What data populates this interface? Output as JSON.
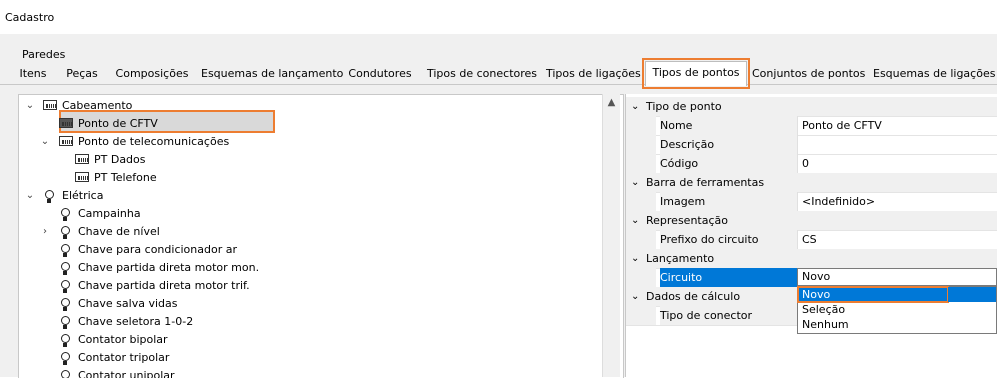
{
  "window": {
    "title": "Cadastro"
  },
  "section_label": "Paredes",
  "tabs": [
    "Itens",
    "Peças",
    "Composições",
    "Esquemas de lançamento",
    "Condutores",
    "Tipos de conectores",
    "Tipos de ligações",
    "Tipos de pontos",
    "Conjuntos de pontos",
    "Esquemas de ligações"
  ],
  "active_tab": "Tipos de pontos",
  "tree": {
    "cabeamento": "Cabeamento",
    "ponto_cftv": "Ponto de CFTV",
    "ponto_telecom": "Ponto de telecomunicações",
    "pt_dados": "PT Dados",
    "pt_telefone": "PT Telefone",
    "eletrica": "Elétrica",
    "eletrica_items": [
      "Campainha",
      "Chave de nível",
      "Chave para condicionador ar",
      "Chave partida direta motor mon.",
      "Chave partida direta motor trif.",
      "Chave salva vidas",
      "Chave seletora 1-0-2",
      "Contator bipolar",
      "Contator tripolar",
      "Contator unipolar"
    ]
  },
  "properties": {
    "cat_tipo": "Tipo de ponto",
    "nome_key": "Nome",
    "nome_val": "Ponto de CFTV",
    "descricao_key": "Descrição",
    "descricao_val": "",
    "codigo_key": "Código",
    "codigo_val": "0",
    "cat_barra": "Barra de ferramentas",
    "imagem_key": "Imagem",
    "imagem_val": "<Indefinido>",
    "cat_repr": "Representação",
    "prefixo_key": "Prefixo do circuito",
    "prefixo_val": "CS",
    "cat_lanc": "Lançamento",
    "circuito_key": "Circuito",
    "circuito_val": "Novo",
    "cat_dados": "Dados de cálculo",
    "conector_key": "Tipo de conector"
  },
  "dropdown_options": [
    "Novo",
    "Seleção",
    "Nenhum"
  ],
  "colors": {
    "highlight": "#ed7d31",
    "selection": "#0078d7"
  }
}
